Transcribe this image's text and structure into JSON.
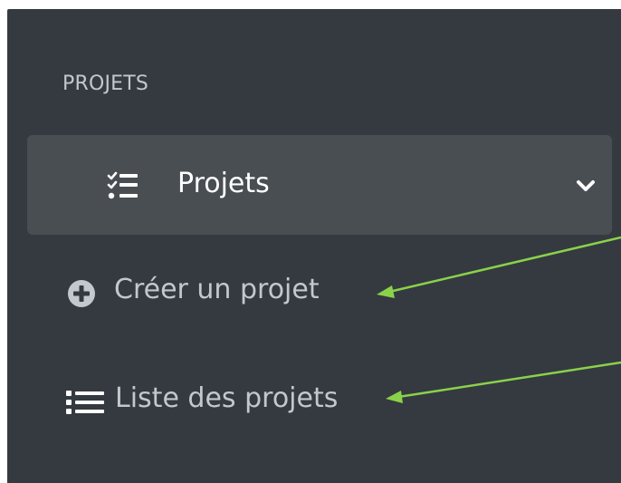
{
  "sidebar": {
    "section_header": "PROJETS",
    "parent_item": {
      "label": "Projets",
      "icon": "tasks-icon",
      "expanded": true
    },
    "children": [
      {
        "label": "Créer un projet",
        "icon": "plus-circle-icon"
      },
      {
        "label": "Liste des projets",
        "icon": "list-icon"
      }
    ]
  },
  "colors": {
    "sidebar_bg": "#343a40",
    "active_item_bg": "#494e53",
    "text_muted": "#c2c7d0",
    "text_active": "#ffffff",
    "annotation_arrow": "#8bd14a"
  }
}
